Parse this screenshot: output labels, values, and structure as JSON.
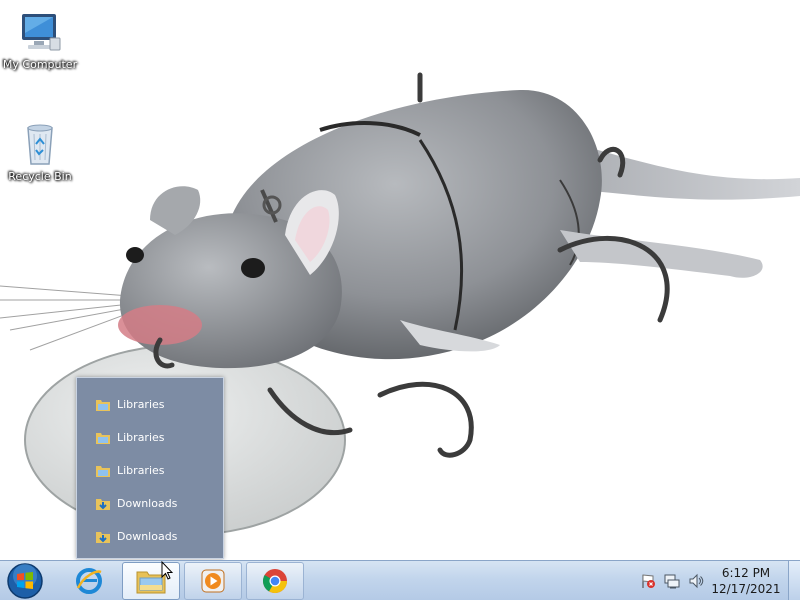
{
  "desktop": {
    "icons": [
      {
        "label": "My Computer",
        "icon": "computer-icon"
      },
      {
        "label": "Recycle Bin",
        "icon": "recycle-bin-icon"
      }
    ],
    "wallpaper": "rat-lure-wallpaper"
  },
  "jumplist": {
    "items": [
      {
        "label": "Libraries",
        "icon": "libraries-folder-icon"
      },
      {
        "label": "Libraries",
        "icon": "libraries-folder-icon"
      },
      {
        "label": "Libraries",
        "icon": "libraries-folder-icon"
      },
      {
        "label": "Downloads",
        "icon": "downloads-folder-icon"
      },
      {
        "label": "Downloads",
        "icon": "downloads-folder-icon"
      }
    ]
  },
  "taskbar": {
    "start": "start-orb-icon",
    "buttons": [
      {
        "name": "internet-explorer",
        "icon": "internet-explorer-icon"
      },
      {
        "name": "windows-explorer",
        "icon": "folder-icon",
        "active": true
      },
      {
        "name": "windows-media-player",
        "icon": "media-player-icon"
      },
      {
        "name": "google-chrome",
        "icon": "chrome-icon"
      }
    ],
    "tray": {
      "icons": [
        "action-center-flag-icon",
        "network-icon",
        "volume-icon"
      ],
      "time": "6:12 PM",
      "date": "12/17/2021"
    }
  },
  "colors": {
    "taskbar_top": "#d6e4f3",
    "taskbar_bottom": "#b4cae6",
    "jumplist_bg": "#7d8ca4",
    "rat_body": "#8e9196"
  }
}
